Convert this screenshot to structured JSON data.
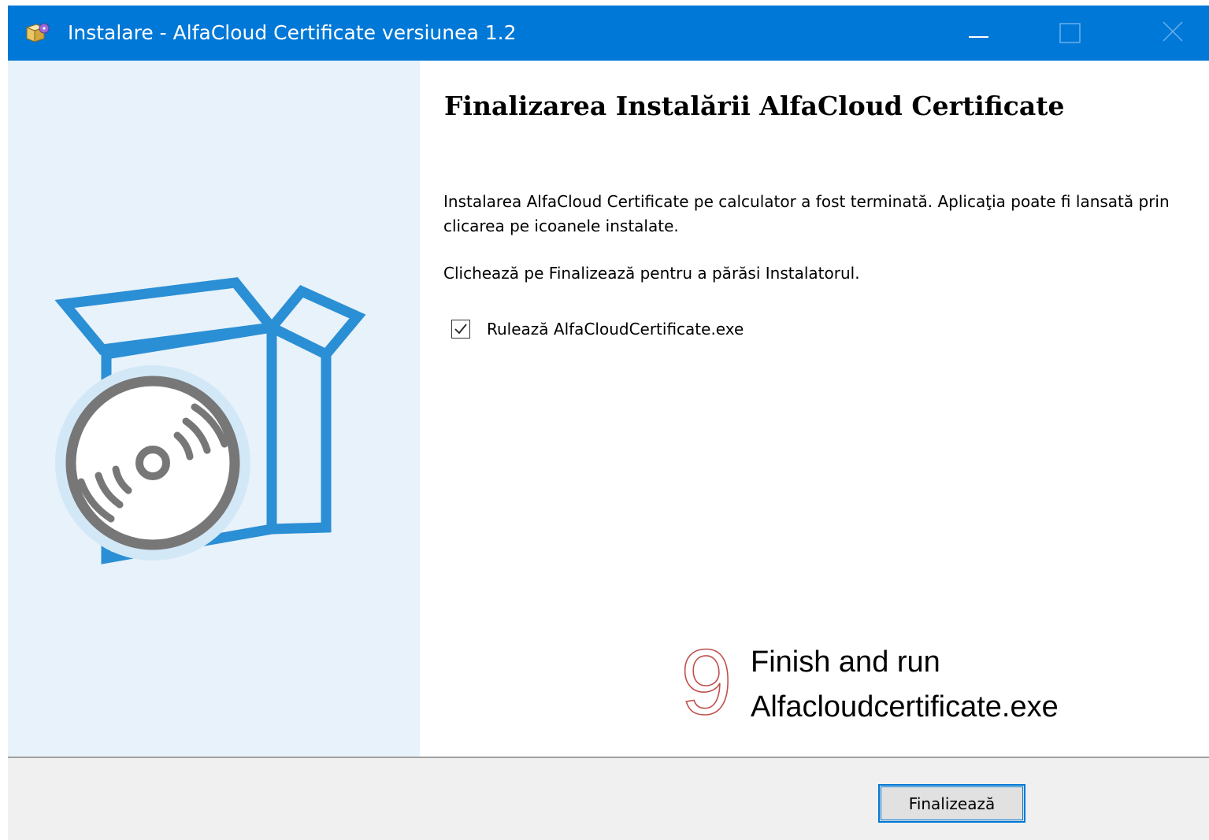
{
  "window": {
    "title": "Instalare - AlfaCloud Certificate versiunea 1.2",
    "app_icon": "installer-box-icon",
    "controls": {
      "minimize_icon": "minimize-icon",
      "maximize_icon": "maximize-icon",
      "close_icon": "close-icon"
    }
  },
  "sidebar": {
    "illustration": "software-box-with-disc-icon"
  },
  "content": {
    "heading": "Finalizarea Instalării AlfaCloud Certificate",
    "paragraph_1": "Instalarea AlfaCloud Certificate pe calculator a fost terminată. Aplicaţia poate fi lansată prin clicarea pe icoanele instalate.",
    "paragraph_2": "Clichează pe Finalizează pentru a părăsi Instalatorul.",
    "run_checkbox": {
      "label": "Rulează AlfaCloudCertificate.exe",
      "checked": true
    }
  },
  "annotation": {
    "step_number": "9",
    "line_1": "Finish and run",
    "line_2": "Alfacloudcertificate.exe"
  },
  "footer": {
    "finish_label": "Finalizează"
  },
  "colors": {
    "titlebar": "#0078d7",
    "sidebar_bg": "#e8f2fa",
    "illustration_blue": "#2a8fd4",
    "disc_gray": "#777777",
    "annotation_red": "#c0504d",
    "footer_bg": "#f0f0f0"
  }
}
